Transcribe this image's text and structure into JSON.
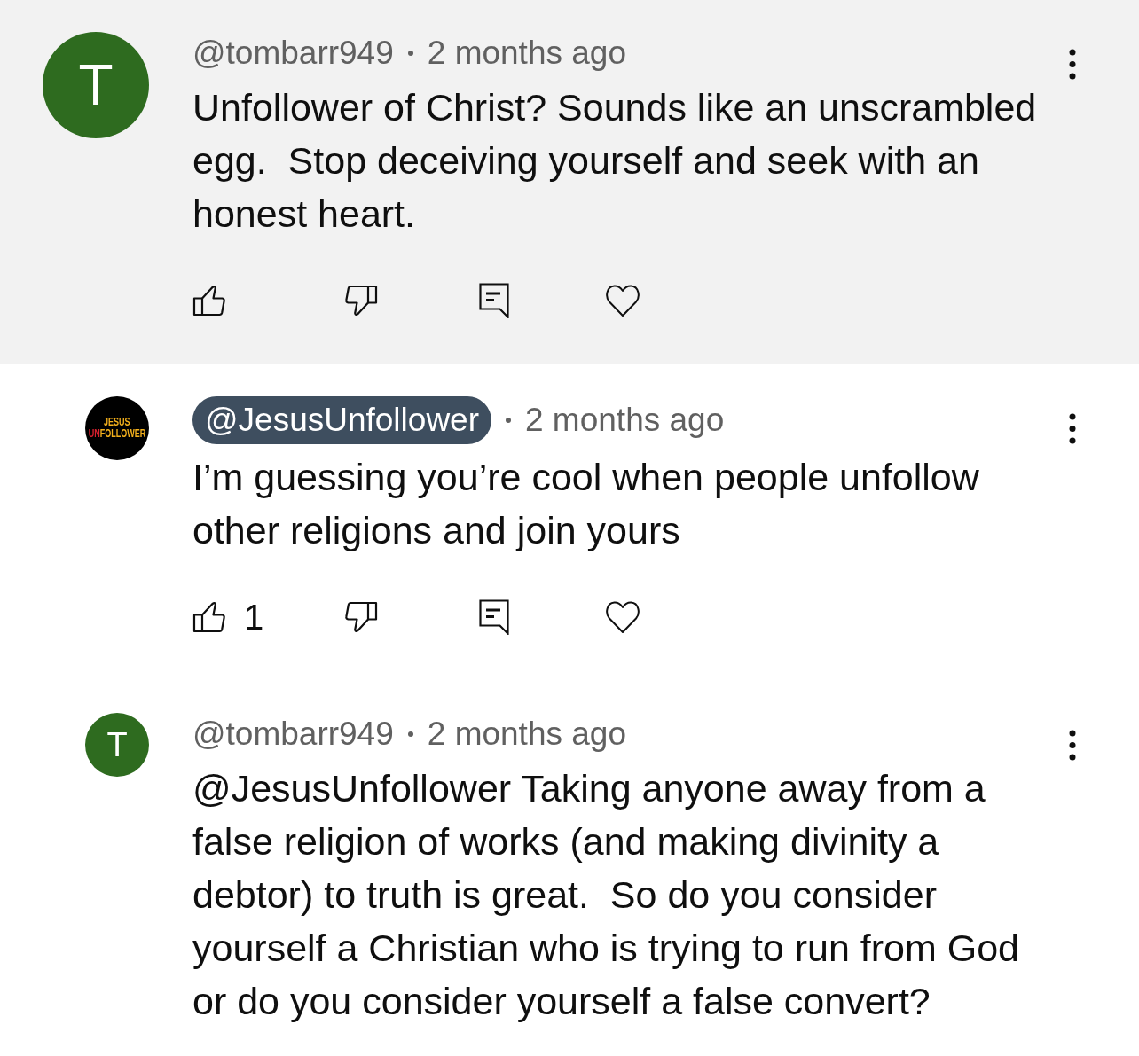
{
  "comments": [
    {
      "kind": "parent",
      "highlighted": true,
      "avatar": {
        "kind": "letter",
        "letter": "T",
        "color": "#2e6b1f"
      },
      "author": "@tombarr949",
      "creator": false,
      "time": "2 months ago",
      "text": "Unfollower of Christ? Sounds like an unscrambled\negg.  Stop deceiving yourself and seek with an\nhonest heart."
    },
    {
      "kind": "reply",
      "highlighted": false,
      "avatar": {
        "kind": "logo",
        "logo_lines": [
          [
            {
              "text": "JESUS",
              "accent": false
            }
          ],
          [
            {
              "text": "UN",
              "accent": true
            },
            {
              "text": "FOLLOWER",
              "accent": false
            }
          ]
        ]
      },
      "author": "@JesusUnfollower",
      "creator": true,
      "time": "2 months ago",
      "text": "I’m guessing you’re cool when people unfollow\nother religions and join yours",
      "likes": "1"
    },
    {
      "kind": "reply",
      "highlighted": false,
      "avatar": {
        "kind": "letter",
        "letter": "T",
        "color": "#2e6b1f"
      },
      "author": "@tombarr949",
      "creator": false,
      "time": "2 months ago",
      "text": "@JesusUnfollower Taking anyone away from a\nfalse religion of works (and making divinity a\ndebtor) to truth is great.  So do you consider\nyourself a Christian who is trying to run from God\nor do you consider yourself a false convert?"
    }
  ]
}
